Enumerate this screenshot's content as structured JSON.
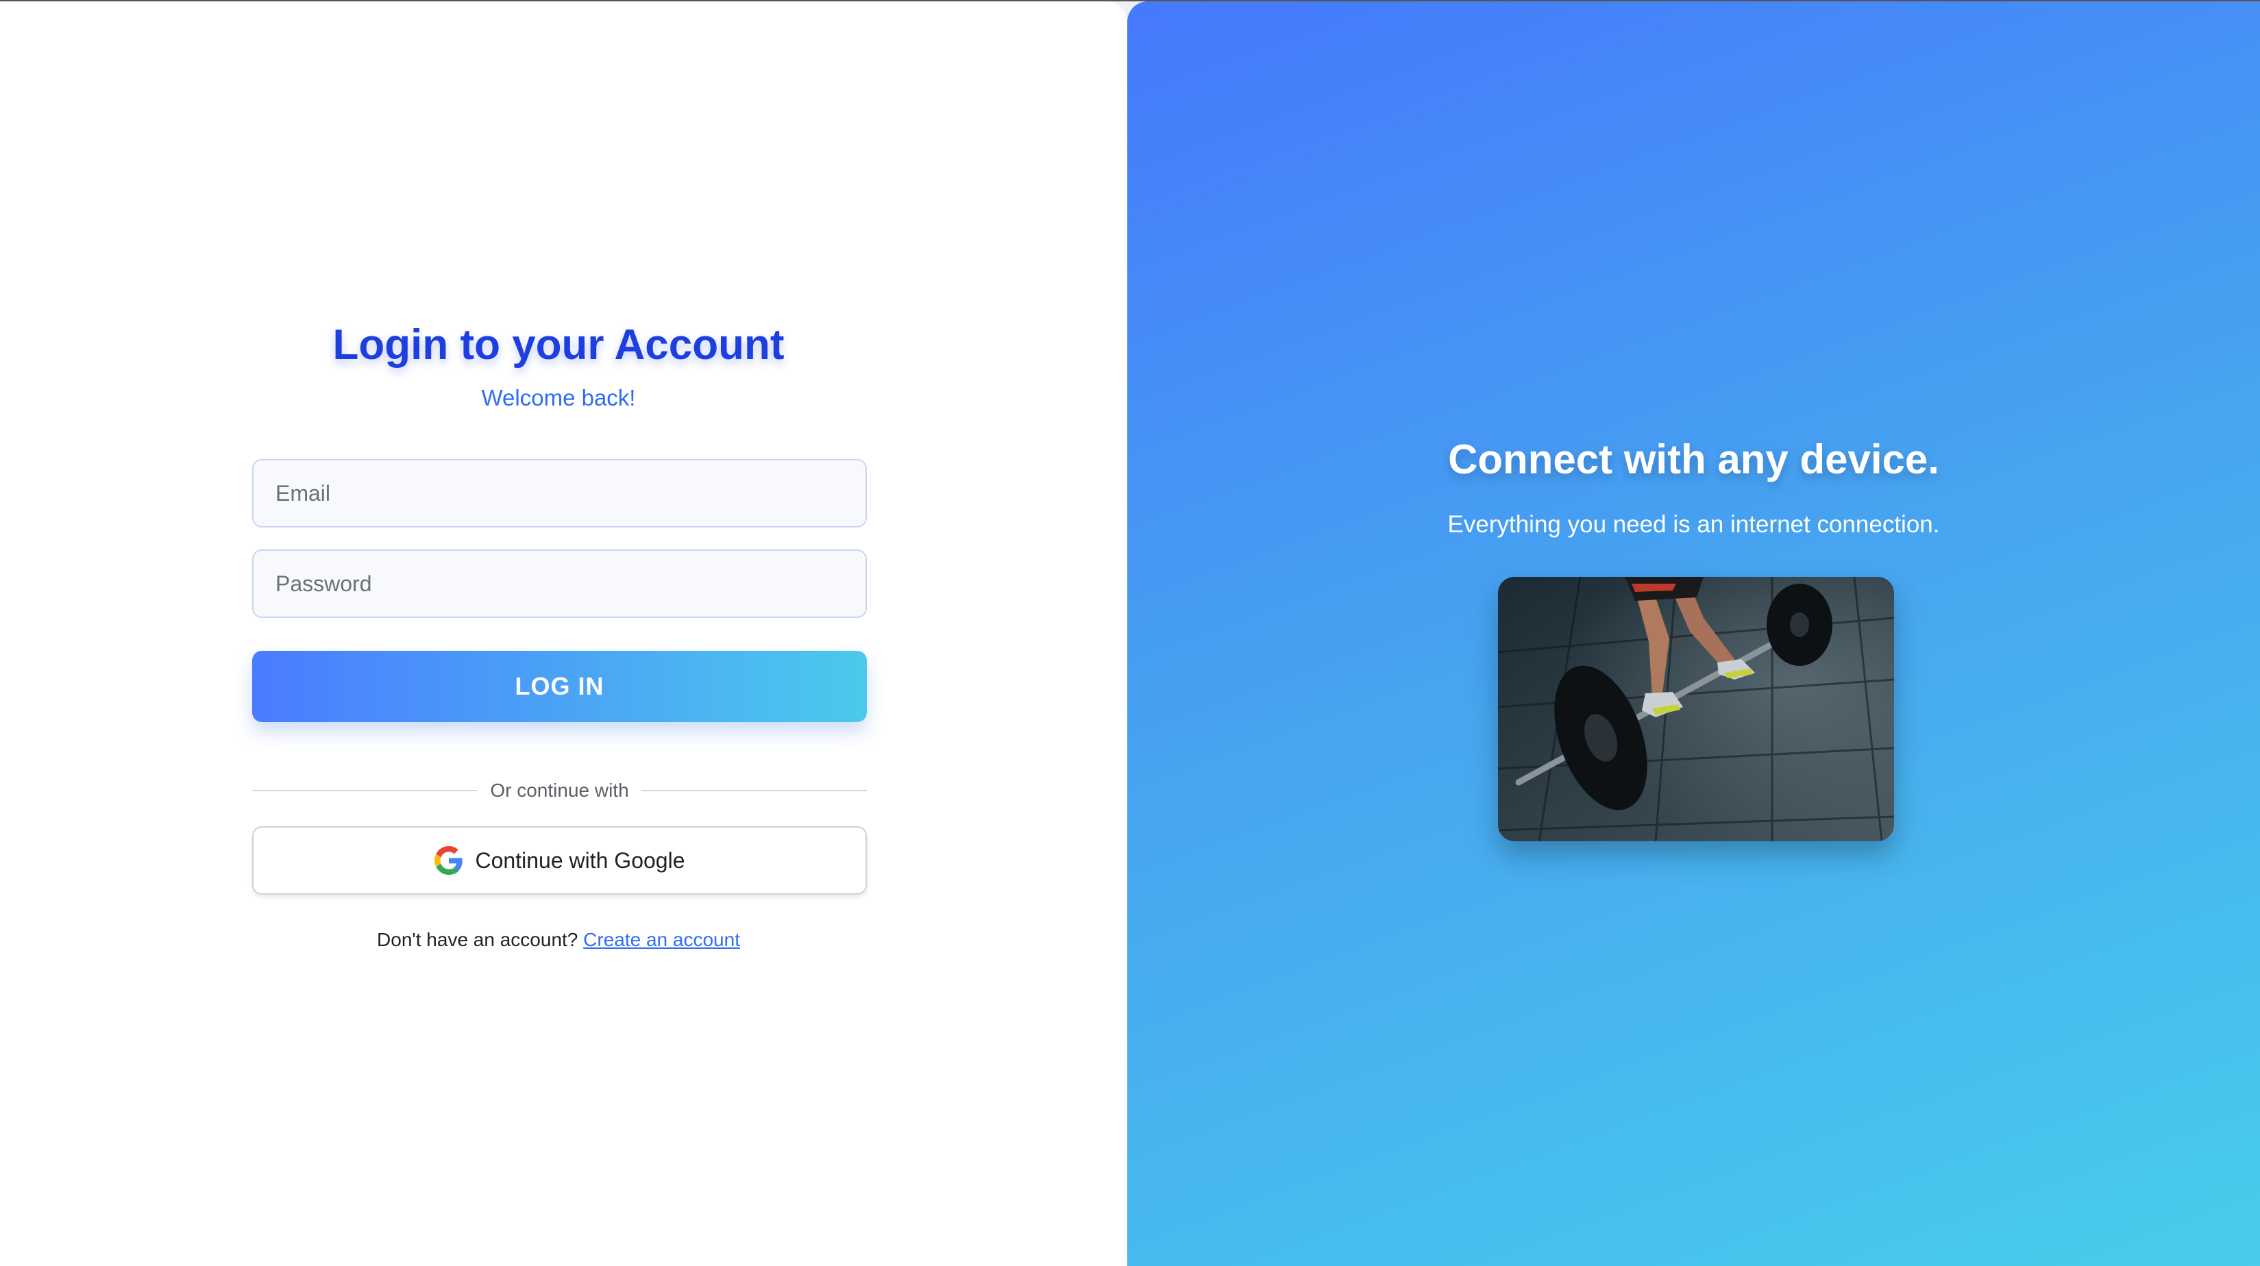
{
  "login": {
    "title": "Login to your Account",
    "subtitle": "Welcome back!",
    "email_placeholder": "Email",
    "password_placeholder": "Password",
    "login_button": "LOG IN",
    "divider_text": "Or continue with",
    "google_button": "Continue with Google",
    "signup_prompt": "Don't have an account?",
    "signup_link": "Create an account"
  },
  "promo": {
    "title": "Connect with any device.",
    "subtitle": "Everything you need is an internet connection.",
    "image_icon": "barbell-deadlift-photo"
  },
  "colors": {
    "title_blue": "#1d3fe0",
    "accent_blue": "#2f6df6",
    "gradient_start": "#4579fd",
    "gradient_end": "#48cdec"
  }
}
